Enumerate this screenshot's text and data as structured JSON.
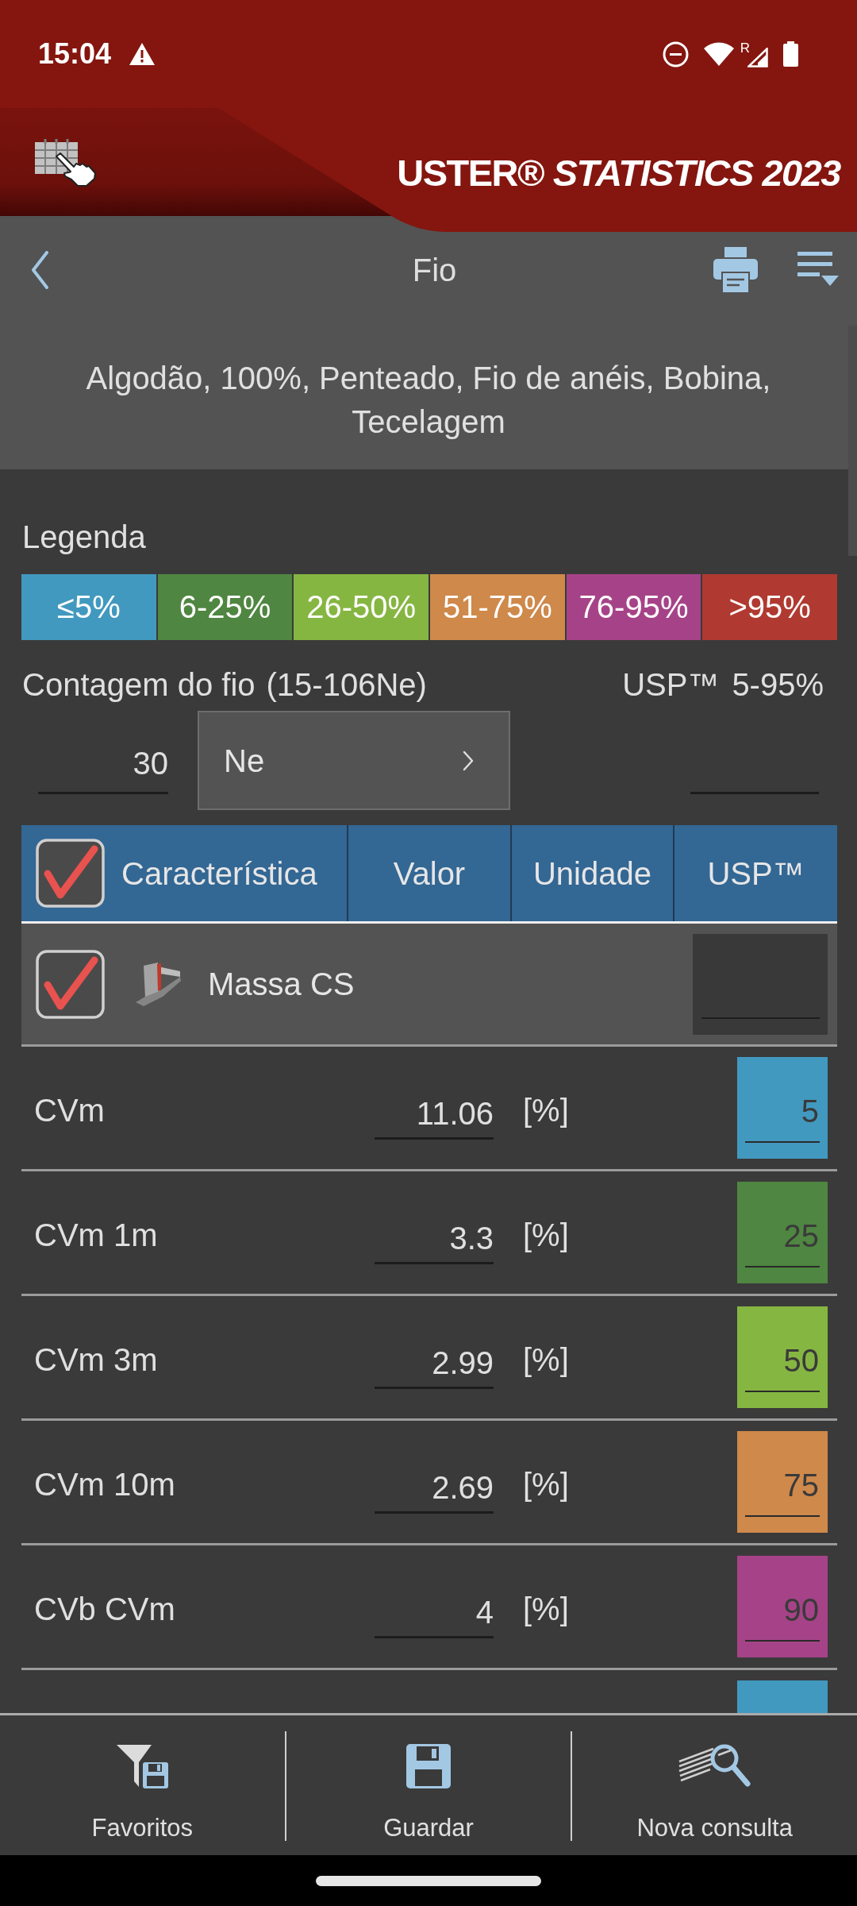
{
  "status_bar": {
    "time": "15:04",
    "roaming": "R"
  },
  "header": {
    "title": "USTER® *STATISTICS 2023*"
  },
  "nav": {
    "title": "Fio"
  },
  "subtitle": "Algodão, 100%, Penteado, Fio de anéis, Bobina, Tecelagem",
  "legend": {
    "label": "Legenda",
    "items": [
      {
        "label": "≤5%",
        "color": "#4299bf"
      },
      {
        "label": "6-25%",
        "color": "#4f8641"
      },
      {
        "label": "26-50%",
        "color": "#86b642"
      },
      {
        "label": "51-75%",
        "color": "#ce894b"
      },
      {
        "label": "76-95%",
        "color": "#a64388"
      },
      {
        "label": ">95%",
        "color": "#b03a31"
      }
    ]
  },
  "yarn_count": {
    "label": "Contagem do fio",
    "range": "(15-106Ne)",
    "usp_label": "USP™",
    "usp_range": "5-95%",
    "value": "30",
    "unit": "Ne"
  },
  "table": {
    "all_checked": true,
    "columns": [
      "Característica",
      "Valor",
      "Unidade",
      "USP™"
    ],
    "groups": [
      {
        "name": "Massa CS",
        "checked": true,
        "rows": [
          {
            "name": "CVm",
            "value": "11.06",
            "unit": "[%]",
            "usp": "5",
            "color": "#4299bf"
          },
          {
            "name": "CVm 1m",
            "value": "3.3",
            "unit": "[%]",
            "usp": "25",
            "color": "#4f8641"
          },
          {
            "name": "CVm 3m",
            "value": "2.99",
            "unit": "[%]",
            "usp": "50",
            "color": "#86b642"
          },
          {
            "name": "CVm 10m",
            "value": "2.69",
            "unit": "[%]",
            "usp": "75",
            "color": "#ce894b"
          },
          {
            "name": "CVb CVm",
            "value": "4",
            "unit": "[%]",
            "usp": "90",
            "color": "#a64388"
          },
          {
            "color": "#4299bf"
          }
        ]
      }
    ]
  },
  "bottom_bar": {
    "buttons": [
      "Favoritos",
      "Guardar",
      "Nova consulta"
    ]
  }
}
